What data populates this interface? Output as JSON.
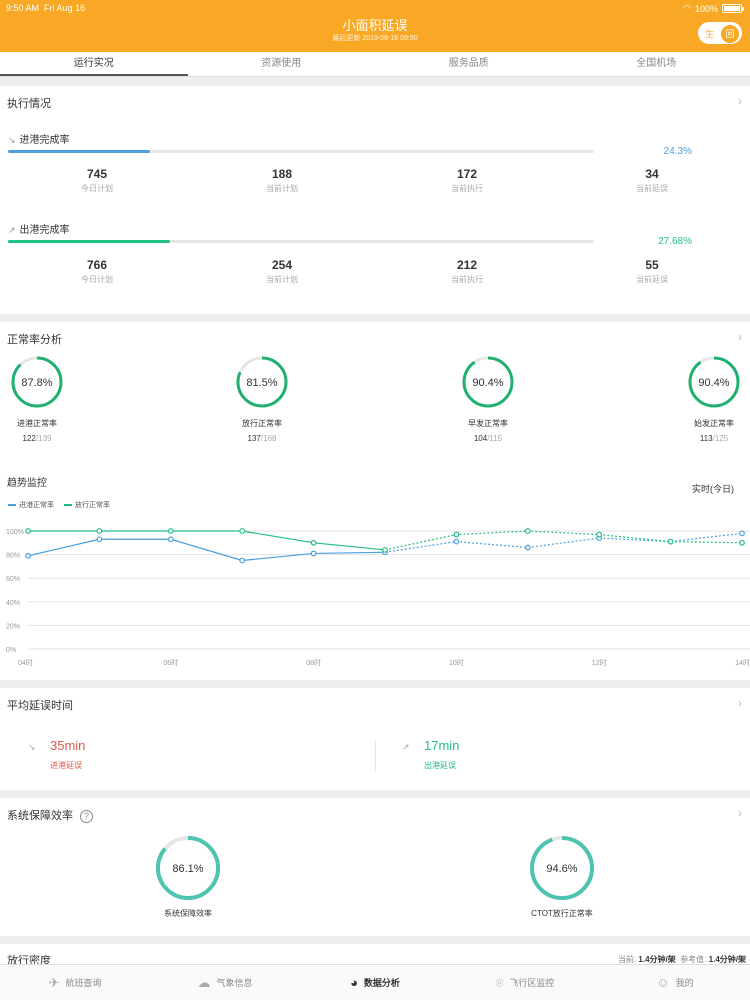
{
  "status": {
    "time": "9:50 AM",
    "date": "Fri Aug 16",
    "battery": "100%"
  },
  "header": {
    "title": "小面积延误",
    "subtitle": "最后更新 2019-08-16 09:50",
    "toggle_left": "生",
    "toggle_right": "回",
    "background": "#f9a825"
  },
  "tabs": [
    {
      "label": "运行实况",
      "active": true
    },
    {
      "label": "资源使用",
      "active": false
    },
    {
      "label": "服务品质",
      "active": false
    },
    {
      "label": "全国机场",
      "active": false
    }
  ],
  "execution": {
    "title": "执行情况",
    "inbound": {
      "label": "进港完成率",
      "rate": "24.3%",
      "rate_value": 0.243,
      "color": "#4a9fe0",
      "stats": [
        {
          "value": "745",
          "label": "今日计划"
        },
        {
          "value": "188",
          "label": "当前计划"
        },
        {
          "value": "172",
          "label": "当前执行"
        },
        {
          "value": "34",
          "label": "当前延误"
        }
      ]
    },
    "outbound": {
      "label": "出港完成率",
      "rate": "27.68%",
      "rate_value": 0.2768,
      "color": "#20c080",
      "stats": [
        {
          "value": "766",
          "label": "今日计划"
        },
        {
          "value": "254",
          "label": "当前计划"
        },
        {
          "value": "212",
          "label": "当前执行"
        },
        {
          "value": "55",
          "label": "当前延误"
        }
      ]
    }
  },
  "normal_rate": {
    "title": "正常率分析",
    "rings": [
      {
        "percent": "87.8%",
        "value": 0.878,
        "name": "进港正常率",
        "num": "122",
        "den": "/139"
      },
      {
        "percent": "81.5%",
        "value": 0.815,
        "name": "放行正常率",
        "num": "137",
        "den": "/168"
      },
      {
        "percent": "90.4%",
        "value": 0.904,
        "name": "早发正常率",
        "num": "104",
        "den": "/115"
      },
      {
        "percent": "90.4%",
        "value": 0.904,
        "name": "始发正常率",
        "num": "113",
        "den": "/125"
      }
    ],
    "ring_color": "#20b070"
  },
  "trend": {
    "title": "趋势监控",
    "period": "实时(今日)"
  },
  "chart_data": {
    "type": "line",
    "x": [
      "04时",
      "05时",
      "06时",
      "07时",
      "08时",
      "09时",
      "10时",
      "11时",
      "12时",
      "13时",
      "14时"
    ],
    "xticks": [
      "04时",
      "06时",
      "08时",
      "10时",
      "12时",
      "14时"
    ],
    "yticks": [
      "0%",
      "20%",
      "40%",
      "60%",
      "80%",
      "100%"
    ],
    "ylim": [
      0,
      100
    ],
    "grid": true,
    "legend": "top-left",
    "series": [
      {
        "name": "进港正常率",
        "color": "#4a9fe0",
        "values": [
          79,
          93,
          93,
          75,
          81,
          82,
          91,
          86,
          94,
          91,
          98
        ]
      },
      {
        "name": "放行正常率",
        "color": "#20c080",
        "values": [
          100,
          100,
          100,
          100,
          90,
          84,
          97,
          100,
          97,
          91,
          90
        ]
      }
    ],
    "solid_until_index": 5
  },
  "delay": {
    "title": "平均延误时间",
    "inbound": {
      "value": "35min",
      "label": "进港延误",
      "color": "#e0584a"
    },
    "outbound": {
      "value": "17min",
      "label": "出港延误",
      "color": "#20c080"
    }
  },
  "efficiency": {
    "title": "系统保障效率",
    "help": "?",
    "rings": [
      {
        "percent": "86.1%",
        "value": 0.861,
        "name": "系统保障效率"
      },
      {
        "percent": "94.6%",
        "value": 0.946,
        "name": "CTOT放行正常率"
      }
    ],
    "ring_color": "#4cc4b0"
  },
  "release_density": {
    "title": "放行密度",
    "current_label": "当前:",
    "current_value": "1.4分钟/架",
    "ref_label": "参考值:",
    "ref_value": "1.4分钟/架"
  },
  "tabbar": [
    {
      "label": "航班查询",
      "icon": "airplane-icon",
      "glyph": "✈",
      "active": false
    },
    {
      "label": "气象信息",
      "icon": "cloud-icon",
      "glyph": "☁",
      "active": false
    },
    {
      "label": "数据分析",
      "icon": "pie-chart-icon",
      "glyph": "◕",
      "active": true
    },
    {
      "label": "飞行区监控",
      "icon": "location-icon",
      "glyph": "⌾",
      "active": false
    },
    {
      "label": "我的",
      "icon": "user-icon",
      "glyph": "☺",
      "active": false
    }
  ]
}
